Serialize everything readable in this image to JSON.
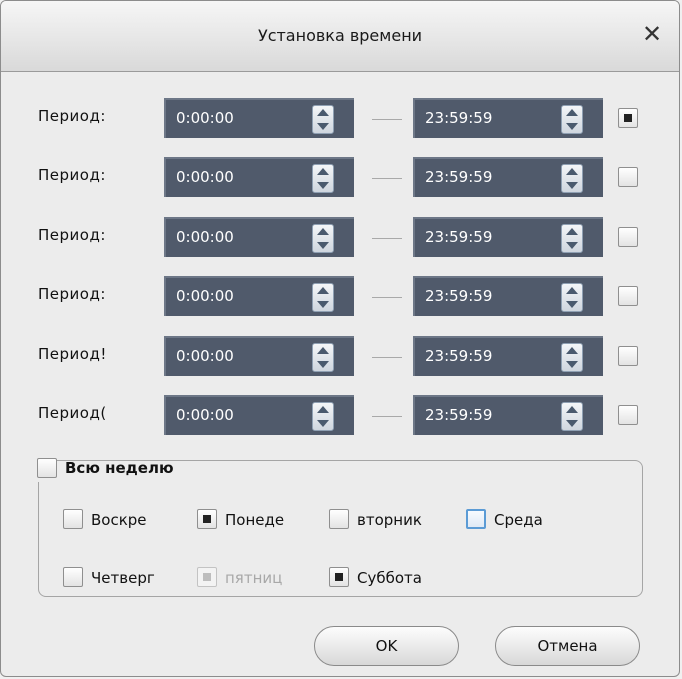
{
  "dialog": {
    "title": "Установка времени",
    "close_glyph": "✕"
  },
  "periods": [
    {
      "label": "Период:",
      "start": "0:00:00",
      "end": "23:59:59",
      "checked": true
    },
    {
      "label": "Период:",
      "start": "0:00:00",
      "end": "23:59:59",
      "checked": false
    },
    {
      "label": "Период:",
      "start": "0:00:00",
      "end": "23:59:59",
      "checked": false
    },
    {
      "label": "Период:",
      "start": "0:00:00",
      "end": "23:59:59",
      "checked": false
    },
    {
      "label": "Период!",
      "start": "0:00:00",
      "end": "23:59:59",
      "checked": false
    },
    {
      "label": "Период(",
      "start": "0:00:00",
      "end": "23:59:59",
      "checked": false
    }
  ],
  "week": {
    "label": "Всю неделю",
    "checked": false,
    "days": [
      {
        "label": "Воскре",
        "checked": false,
        "disabled": false,
        "focused": false
      },
      {
        "label": "Понеде",
        "checked": true,
        "disabled": false,
        "focused": false
      },
      {
        "label": "вторник",
        "checked": false,
        "disabled": false,
        "focused": false
      },
      {
        "label": "Среда",
        "checked": false,
        "disabled": false,
        "focused": true
      },
      {
        "label": "Четверг",
        "checked": false,
        "disabled": false,
        "focused": false
      },
      {
        "label": "пятниц",
        "checked": true,
        "disabled": true,
        "focused": false
      },
      {
        "label": "Суббота",
        "checked": true,
        "disabled": false,
        "focused": false
      }
    ]
  },
  "buttons": {
    "ok": "OK",
    "cancel": "Отмена"
  },
  "colors": {
    "time_field_bg": "#505a6b",
    "focus_border": "#5b9bd5"
  },
  "icons": {
    "spinner": "spin-up-down-icon",
    "close": "close-icon"
  }
}
